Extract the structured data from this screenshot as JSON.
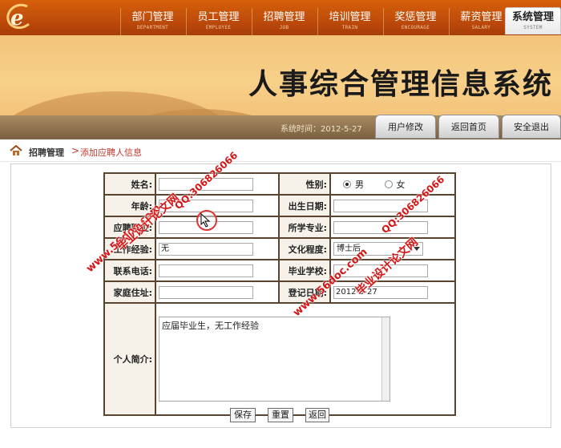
{
  "nav": {
    "logo_letter": "e",
    "tabs": [
      {
        "label": "部门管理",
        "sub": "DEPARTMENT"
      },
      {
        "label": "员工管理",
        "sub": "EMPLOYEE"
      },
      {
        "label": "招聘管理",
        "sub": "JOB"
      },
      {
        "label": "培训管理",
        "sub": "TRAIN"
      },
      {
        "label": "奖惩管理",
        "sub": "ENCOURAGE"
      },
      {
        "label": "薪资管理",
        "sub": "SALARY"
      },
      {
        "label": "系统管理",
        "sub": "SYSTEM"
      }
    ],
    "active_index": 6
  },
  "banner": {
    "title": "人事综合管理信息系统",
    "time_label": "系统时间：",
    "time_value": "2012-5-27",
    "buttons": [
      "用户修改",
      "返回首页",
      "安全退出"
    ]
  },
  "breadcrumb": {
    "section": "招聘管理",
    "separator": ">",
    "page": "添加应聘人信息"
  },
  "form": {
    "labels": {
      "name": "姓名:",
      "gender": "性别:",
      "age": "年龄:",
      "birthday": "出生日期:",
      "phone_pre": "应聘职位:",
      "major": "所学专业:",
      "experience": "工作经验:",
      "education": "文化程度:",
      "tel": "联系电话:",
      "school": "毕业学校:",
      "address": "家庭住址:",
      "regdate": "登记日期:",
      "intro": "个人简介:"
    },
    "values": {
      "name": "",
      "age": "",
      "position": "",
      "experience": "无",
      "tel": "",
      "address": "",
      "birthday": "",
      "major": "",
      "education": "博士后",
      "school": "",
      "regdate": "2012-5-27",
      "intro": "应届毕业生，无工作经验"
    },
    "gender_options": [
      "男",
      "女"
    ],
    "gender_selected": 0,
    "buttons": {
      "save": "保存",
      "reset": "重置",
      "back": "返回"
    }
  },
  "watermarks": {
    "site": "www.56doc.com",
    "qq": "QQ:306826066",
    "brand": "毕业设计论文网"
  },
  "colors": {
    "nav_bg": "#c25210",
    "table_border": "#5a4430",
    "accent_red": "#c0392b",
    "watermark": "#d51515"
  }
}
